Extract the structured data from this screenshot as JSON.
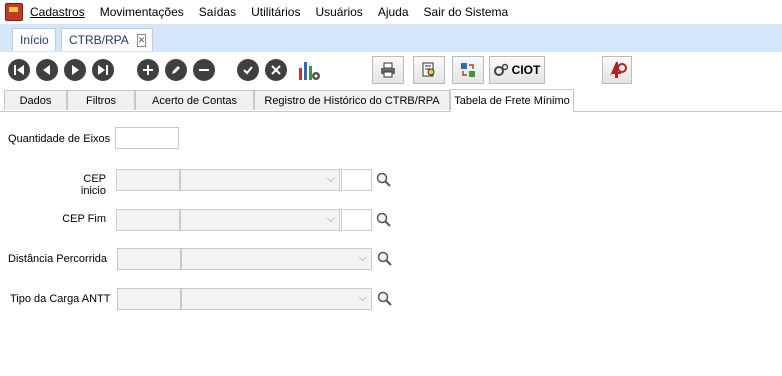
{
  "menu": {
    "items": [
      "Cadastros",
      "Movimentações",
      "Saídas",
      "Utilitários",
      "Usuários",
      "Ajuda",
      "Sair do Sistema"
    ]
  },
  "tabs": {
    "home": "Início",
    "doc": "CTRB/RPA",
    "close_glyph": "✕"
  },
  "toolbar": {
    "ciot_label": "CIOT"
  },
  "subtabs": [
    "Dados",
    "Filtros",
    "Acerto de Contas",
    "Registro de Histórico do CTRB/RPA",
    "Tabela de Frete Mínimo"
  ],
  "form": {
    "qtd_eixos_label": "Quantidade de Eixos",
    "cep_inicio_label": "CEP inicio",
    "cep_fim_label": "CEP Fim",
    "distancia_label": "Distância Percorrida",
    "tipo_carga_label": "Tipo da Carga ANTT",
    "chevron": "⌵"
  }
}
